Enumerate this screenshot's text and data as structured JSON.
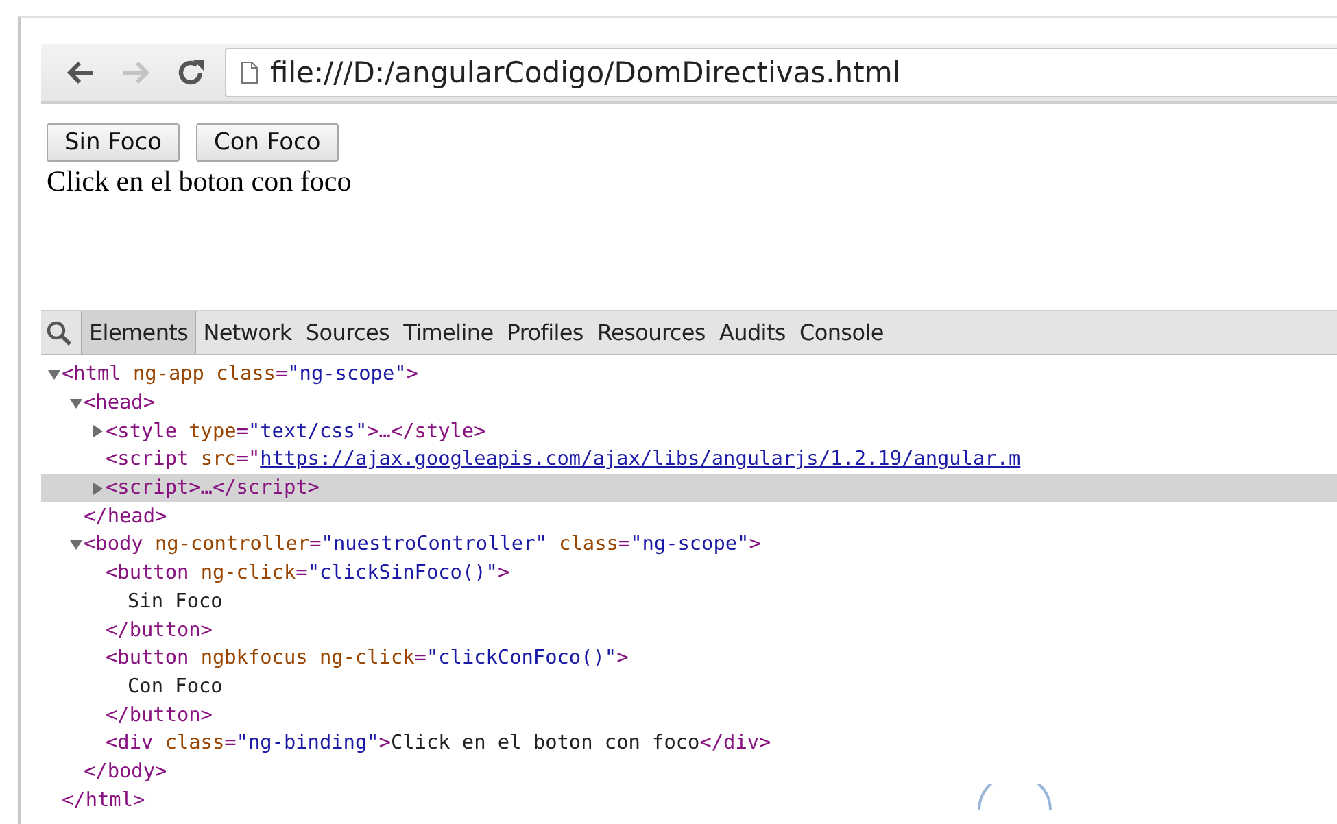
{
  "toolbar": {
    "back": {
      "disabled": false
    },
    "forward": {
      "disabled": true
    },
    "address": "file:///D:/angularCodigo/DomDirectivas.html"
  },
  "page": {
    "buttons": [
      "Sin Foco",
      "Con Foco"
    ],
    "message": "Click en el boton con foco"
  },
  "devtools": {
    "tabs": [
      {
        "label": "Elements",
        "selected": true
      },
      {
        "label": "Network",
        "selected": false
      },
      {
        "label": "Sources",
        "selected": false
      },
      {
        "label": "Timeline",
        "selected": false
      },
      {
        "label": "Profiles",
        "selected": false
      },
      {
        "label": "Resources",
        "selected": false
      },
      {
        "label": "Audits",
        "selected": false
      },
      {
        "label": "Console",
        "selected": false
      }
    ],
    "tree": [
      {
        "expanded": true,
        "selected": false,
        "tokens": [
          {
            "kind": "tag",
            "text": "<html"
          },
          {
            "kind": "attr",
            "text": " ng-app class"
          },
          {
            "kind": "tag",
            "text": "="
          },
          {
            "kind": "value",
            "text": "\"ng-scope\""
          },
          {
            "kind": "tag",
            "text": ">"
          }
        ],
        "children": [
          {
            "expanded": true,
            "selected": false,
            "tokens": [
              {
                "kind": "tag",
                "text": "<head>"
              }
            ],
            "children": [
              {
                "expanded": false,
                "selected": false,
                "tokens": [
                  {
                    "kind": "tag",
                    "text": "<style"
                  },
                  {
                    "kind": "attr",
                    "text": " type"
                  },
                  {
                    "kind": "tag",
                    "text": "="
                  },
                  {
                    "kind": "value",
                    "text": "\"text/css\""
                  },
                  {
                    "kind": "tag",
                    "text": ">…</style>"
                  }
                ]
              },
              {
                "selected": false,
                "tokens": [
                  {
                    "kind": "tag",
                    "text": "<script"
                  },
                  {
                    "kind": "attr",
                    "text": " src"
                  },
                  {
                    "kind": "tag",
                    "text": "=\""
                  },
                  {
                    "kind": "link",
                    "text": "https://ajax.googleapis.com/ajax/libs/angularjs/1.2.19/angular.m"
                  }
                ]
              },
              {
                "expanded": false,
                "selected": true,
                "tokens": [
                  {
                    "kind": "tag",
                    "text": "<script>…</script>"
                  }
                ]
              }
            ],
            "close": [
              {
                "kind": "tag",
                "text": "</head>"
              }
            ]
          },
          {
            "expanded": true,
            "selected": false,
            "tokens": [
              {
                "kind": "tag",
                "text": "<body"
              },
              {
                "kind": "attr",
                "text": " ng-controller"
              },
              {
                "kind": "tag",
                "text": "="
              },
              {
                "kind": "value",
                "text": "\"nuestroController\""
              },
              {
                "kind": "attr",
                "text": " class"
              },
              {
                "kind": "tag",
                "text": "="
              },
              {
                "kind": "value",
                "text": "\"ng-scope\""
              },
              {
                "kind": "tag",
                "text": ">"
              }
            ],
            "children": [
              {
                "selected": false,
                "tokens": [
                  {
                    "kind": "tag",
                    "text": "<button"
                  },
                  {
                    "kind": "attr",
                    "text": " ng-click"
                  },
                  {
                    "kind": "tag",
                    "text": "="
                  },
                  {
                    "kind": "value",
                    "text": "\"clickSinFoco()\""
                  },
                  {
                    "kind": "tag",
                    "text": ">"
                  }
                ],
                "children": [
                  {
                    "selected": false,
                    "tokens": [
                      {
                        "kind": "text",
                        "text": "Sin Foco"
                      }
                    ]
                  }
                ],
                "close": [
                  {
                    "kind": "tag",
                    "text": "</button>"
                  }
                ]
              },
              {
                "selected": false,
                "tokens": [
                  {
                    "kind": "tag",
                    "text": "<button"
                  },
                  {
                    "kind": "attr",
                    "text": " ngbkfocus ng-click"
                  },
                  {
                    "kind": "tag",
                    "text": "="
                  },
                  {
                    "kind": "value",
                    "text": "\"clickConFoco()\""
                  },
                  {
                    "kind": "tag",
                    "text": ">"
                  }
                ],
                "children": [
                  {
                    "selected": false,
                    "tokens": [
                      {
                        "kind": "text",
                        "text": "Con Foco"
                      }
                    ]
                  }
                ],
                "close": [
                  {
                    "kind": "tag",
                    "text": "</button>"
                  }
                ]
              },
              {
                "selected": false,
                "tokens": [
                  {
                    "kind": "tag",
                    "text": "<div"
                  },
                  {
                    "kind": "attr",
                    "text": " class"
                  },
                  {
                    "kind": "tag",
                    "text": "="
                  },
                  {
                    "kind": "value",
                    "text": "\"ng-binding\""
                  },
                  {
                    "kind": "tag",
                    "text": ">"
                  },
                  {
                    "kind": "text",
                    "text": "Click en el boton con foco"
                  },
                  {
                    "kind": "tag",
                    "text": "</div>"
                  }
                ]
              }
            ],
            "close": [
              {
                "kind": "tag",
                "text": "</body>"
              }
            ]
          }
        ],
        "close": [
          {
            "kind": "tag",
            "text": "</html>"
          }
        ]
      }
    ]
  }
}
